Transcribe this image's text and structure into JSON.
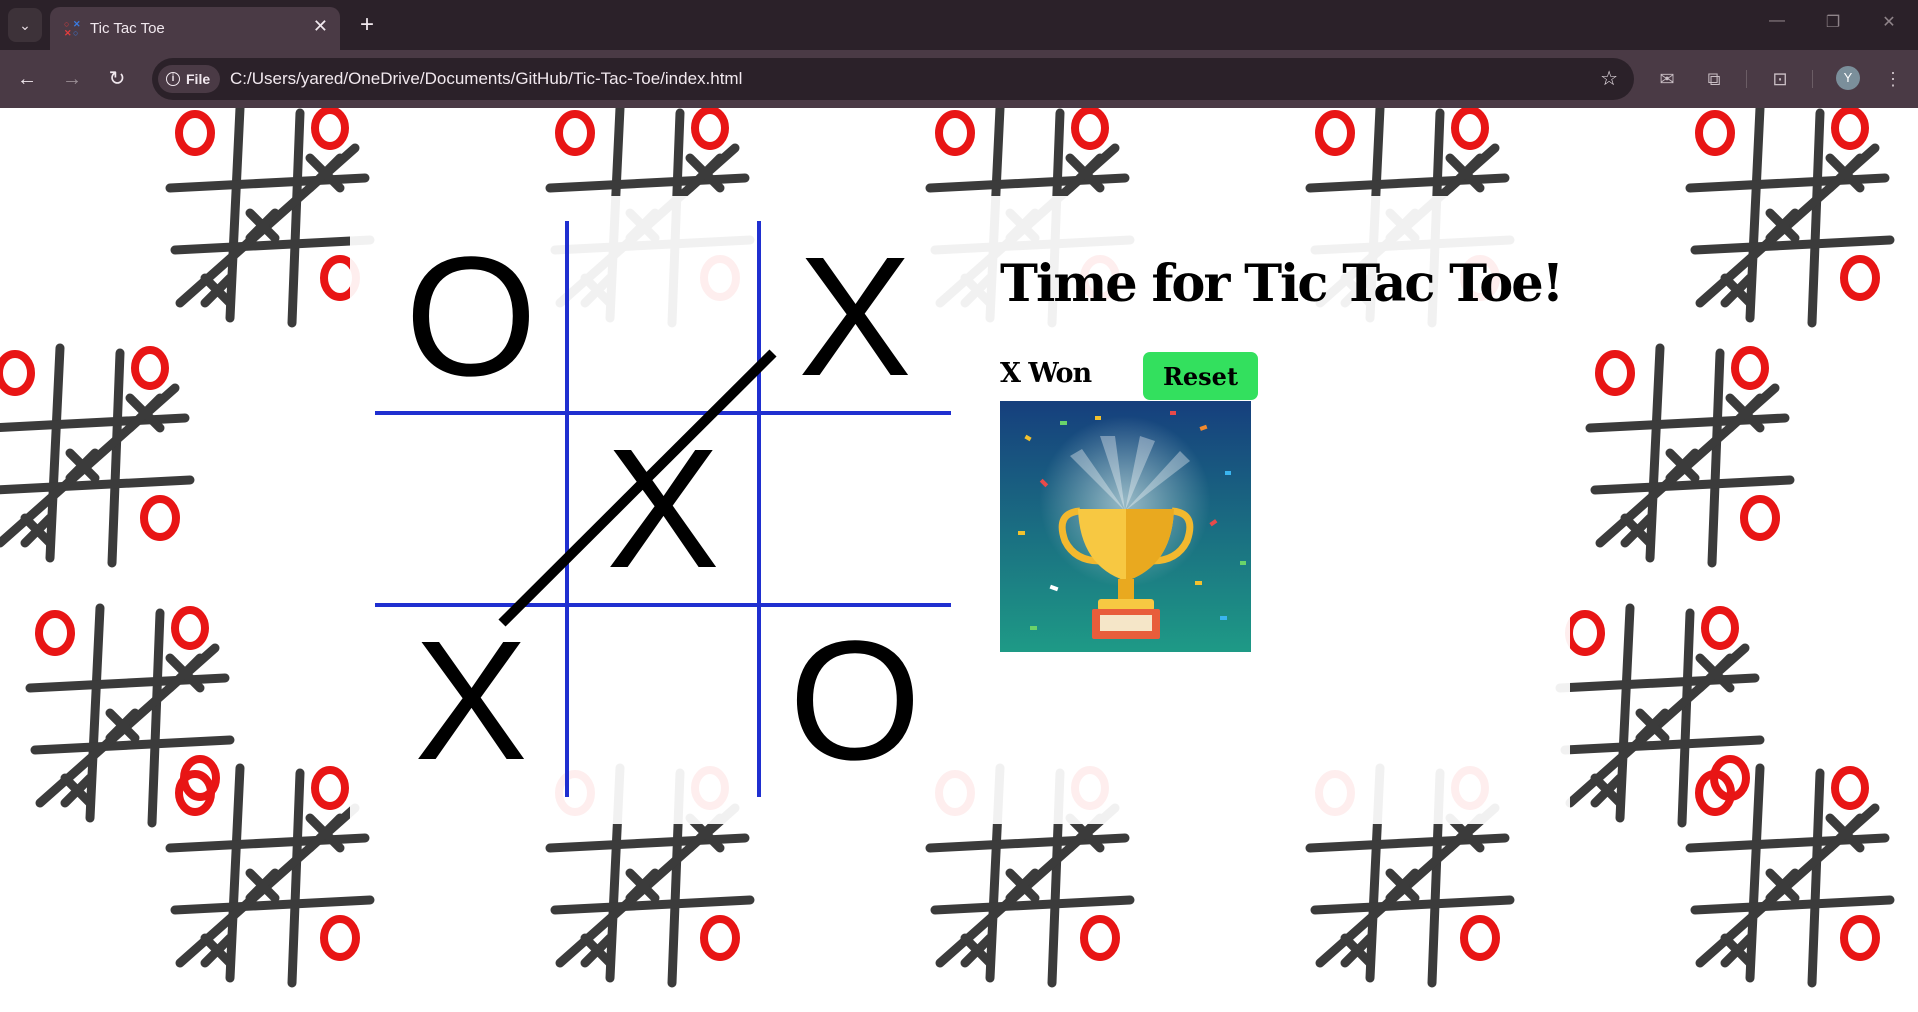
{
  "browser": {
    "tab_title": "Tic Tac Toe",
    "tab_close_glyph": "✕",
    "new_tab_glyph": "+",
    "tab_menu_glyph": "⌄",
    "chip_label": "File",
    "chip_icon_glyph": "i",
    "url": "C:/Users/yared/OneDrive/Documents/GitHub/Tic-Tac-Toe/index.html",
    "profile_initial": "Y",
    "icons": [
      "tab-search-icon",
      "back-icon",
      "forward-icon",
      "reload-icon",
      "site-info-icon",
      "bookmark-star-icon",
      "mail-icon",
      "extensions-icon",
      "screenshot-icon",
      "profile-avatar",
      "menu-icon",
      "minimize-icon",
      "restore-icon",
      "close-window-icon"
    ]
  },
  "game": {
    "title": "Time for Tic Tac Toe!",
    "status": "X Won",
    "reset_label": "Reset",
    "board": [
      "O",
      "",
      "X",
      "",
      "X",
      "",
      "X",
      "",
      "O"
    ],
    "winning_line": "diagonal from bottom-left to top-right",
    "trophy_icon": "trophy-icon"
  },
  "colors": {
    "grid_lines": "#1f2fd0",
    "reset_button": "#33e05e",
    "background_o": "#e81515",
    "background_lines": "#3b3b3b"
  }
}
